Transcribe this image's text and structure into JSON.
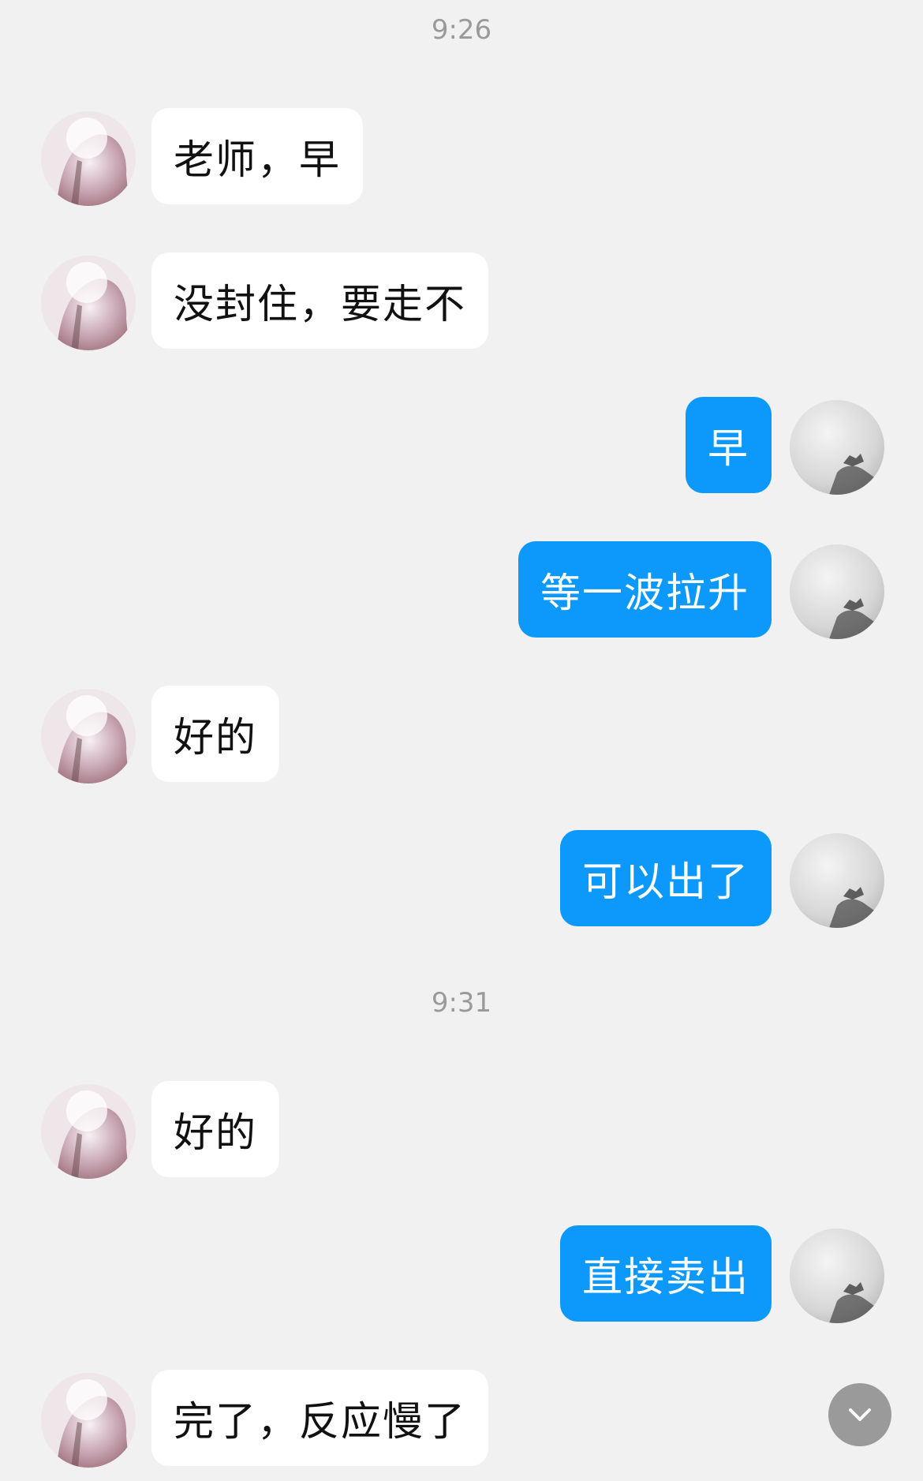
{
  "chat": {
    "items": [
      {
        "type": "time",
        "text": "9:26"
      },
      {
        "type": "msg",
        "side": "in",
        "text": "老师，早"
      },
      {
        "type": "msg",
        "side": "in",
        "text": "没封住，要走不"
      },
      {
        "type": "msg",
        "side": "out",
        "text": "早"
      },
      {
        "type": "msg",
        "side": "out",
        "text": "等一波拉升"
      },
      {
        "type": "msg",
        "side": "in",
        "text": "好的"
      },
      {
        "type": "msg",
        "side": "out",
        "text": "可以出了"
      },
      {
        "type": "time",
        "text": "9:31"
      },
      {
        "type": "msg",
        "side": "in",
        "text": "好的"
      },
      {
        "type": "msg",
        "side": "out",
        "text": "直接卖出"
      },
      {
        "type": "msg",
        "side": "in",
        "text": "完了，反应慢了"
      }
    ]
  },
  "icons": {
    "contact_avatar": "contact-avatar",
    "self_avatar": "self-avatar",
    "scroll_down": "chevron-down-icon"
  },
  "colors": {
    "background": "#f1f1f1",
    "incoming_bubble": "#ffffff",
    "outgoing_bubble": "#0d99fc",
    "timestamp": "#9a9a9a"
  }
}
